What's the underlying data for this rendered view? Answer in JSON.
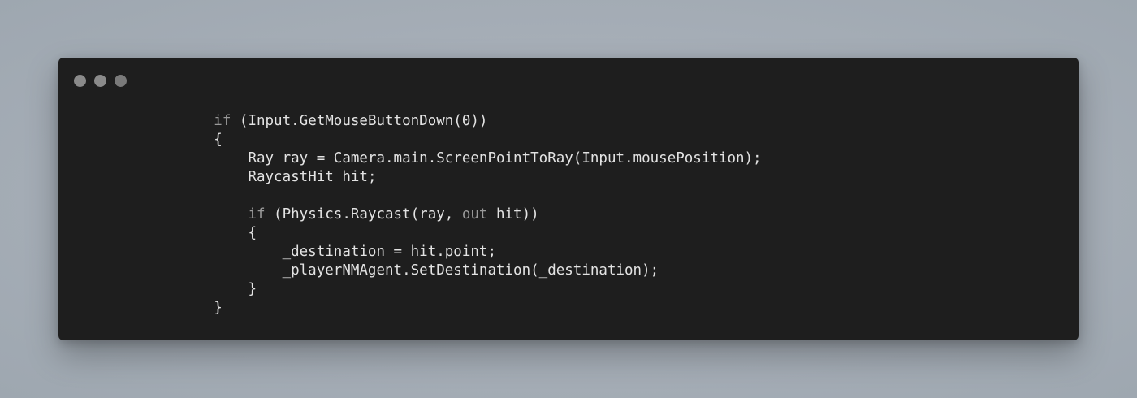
{
  "colors": {
    "page_background": "#a6aeb7",
    "window_background": "#1e1e1e",
    "code_text": "#e3e3e3",
    "keyword_text": "#9a9a9a",
    "control_dots": [
      "#8a8a8a",
      "#8a8a8a",
      "#7a7a7a"
    ]
  },
  "window": {
    "controls": [
      {
        "name": "close-dot"
      },
      {
        "name": "minimize-dot"
      },
      {
        "name": "maximize-dot"
      }
    ]
  },
  "code": {
    "language": "csharp",
    "lines": [
      {
        "indent": "        ",
        "tokens": [
          {
            "t": "if",
            "k": "kw"
          },
          {
            "t": " (Input.GetMouseButtonDown(0))",
            "k": "tx"
          }
        ]
      },
      {
        "indent": "        ",
        "tokens": [
          {
            "t": "{",
            "k": "tx"
          }
        ]
      },
      {
        "indent": "            ",
        "tokens": [
          {
            "t": "Ray ray = Camera.main.ScreenPointToRay(Input.mousePosition);",
            "k": "tx"
          }
        ]
      },
      {
        "indent": "            ",
        "tokens": [
          {
            "t": "RaycastHit hit;",
            "k": "tx"
          }
        ]
      },
      {
        "indent": "",
        "tokens": []
      },
      {
        "indent": "            ",
        "tokens": [
          {
            "t": "if",
            "k": "kw"
          },
          {
            "t": " (Physics.Raycast(ray, ",
            "k": "tx"
          },
          {
            "t": "out",
            "k": "kw"
          },
          {
            "t": " hit))",
            "k": "tx"
          }
        ]
      },
      {
        "indent": "            ",
        "tokens": [
          {
            "t": "{",
            "k": "tx"
          }
        ]
      },
      {
        "indent": "                ",
        "tokens": [
          {
            "t": "_destination = hit.point;",
            "k": "tx"
          }
        ]
      },
      {
        "indent": "                ",
        "tokens": [
          {
            "t": "_playerNMAgent.SetDestination(_destination);",
            "k": "tx"
          }
        ]
      },
      {
        "indent": "            ",
        "tokens": [
          {
            "t": "}",
            "k": "tx"
          }
        ]
      },
      {
        "indent": "        ",
        "tokens": [
          {
            "t": "}",
            "k": "tx"
          }
        ]
      }
    ]
  }
}
